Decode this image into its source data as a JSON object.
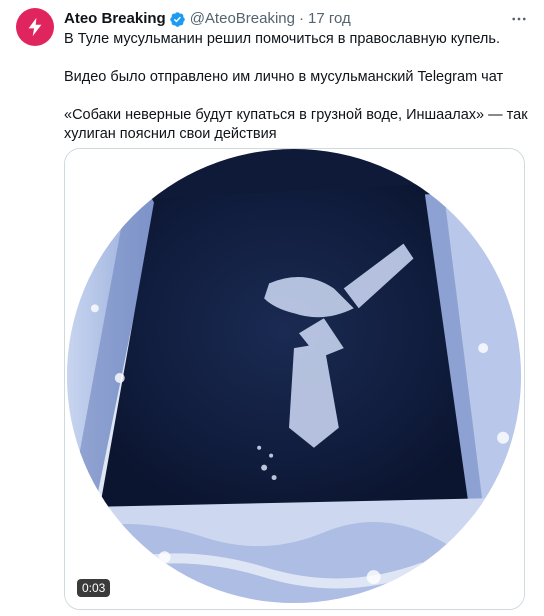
{
  "author": {
    "name": "Ateo Breaking",
    "handle": "@AteoBreaking",
    "separator": "·",
    "time": "17 год"
  },
  "icons": {
    "avatar": "lightning-bolt-icon",
    "verified": "verified-badge-icon",
    "more": "more-horizontal-icon"
  },
  "colors": {
    "avatar_bg": "#e0245e",
    "verified": "#1d9bf0",
    "secondary_text": "#536471"
  },
  "tweet": {
    "paragraphs": [
      "В Туле мусульманин решил помочиться в православную купель.",
      "Видео было отправлено им лично в мусульманский Telegram чат",
      "«Собаки неверные будут купаться в грузной воде, Иншаалах» — так хулиган пояснил свои действия"
    ]
  },
  "video": {
    "duration": "0:03"
  }
}
